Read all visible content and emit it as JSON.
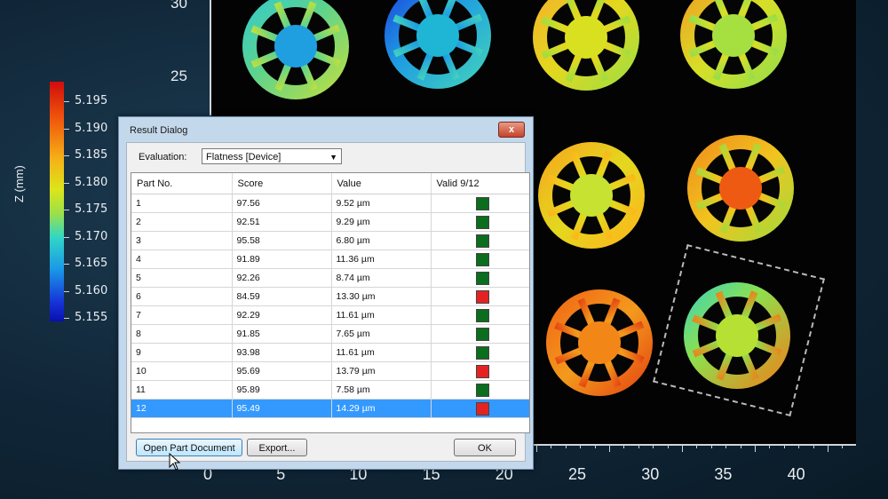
{
  "plot": {
    "y_ticks": [
      "30",
      "25"
    ],
    "x_ticks": [
      "0",
      "5",
      "10",
      "15",
      "20",
      "25",
      "30",
      "35",
      "40"
    ]
  },
  "colorbar": {
    "axis_title": "Z (mm)",
    "labels": [
      "5.195",
      "5.190",
      "5.185",
      "5.180",
      "5.175",
      "5.170",
      "5.165",
      "5.160",
      "5.155"
    ]
  },
  "dialog": {
    "title": "Result Dialog",
    "close_label": "x",
    "evaluation_label": "Evaluation:",
    "evaluation_value": "Flatness [Device]",
    "columns": [
      "Part No.",
      "Score",
      "Value",
      "Valid 9/12"
    ],
    "rows": [
      {
        "part": "1",
        "score": "97.56",
        "value": "9.52 µm",
        "valid": true
      },
      {
        "part": "2",
        "score": "92.51",
        "value": "9.29 µm",
        "valid": true
      },
      {
        "part": "3",
        "score": "95.58",
        "value": "6.80 µm",
        "valid": true
      },
      {
        "part": "4",
        "score": "91.89",
        "value": "11.36 µm",
        "valid": true
      },
      {
        "part": "5",
        "score": "92.26",
        "value": "8.74 µm",
        "valid": true
      },
      {
        "part": "6",
        "score": "84.59",
        "value": "13.30 µm",
        "valid": false
      },
      {
        "part": "7",
        "score": "92.29",
        "value": "11.61 µm",
        "valid": true
      },
      {
        "part": "8",
        "score": "91.85",
        "value": "7.65 µm",
        "valid": true
      },
      {
        "part": "9",
        "score": "93.98",
        "value": "11.61 µm",
        "valid": true
      },
      {
        "part": "10",
        "score": "95.69",
        "value": "13.79 µm",
        "valid": false
      },
      {
        "part": "11",
        "score": "95.89",
        "value": "7.58 µm",
        "valid": true
      },
      {
        "part": "12",
        "score": "95.49",
        "value": "14.29 µm",
        "valid": false
      }
    ],
    "selected_row": 12,
    "buttons": {
      "open_part": "Open Part Document",
      "export": "Export...",
      "ok": "OK"
    }
  },
  "colors": {
    "valid": "#0a6e1e",
    "invalid": "#e52222",
    "selection": "#3399ff"
  }
}
